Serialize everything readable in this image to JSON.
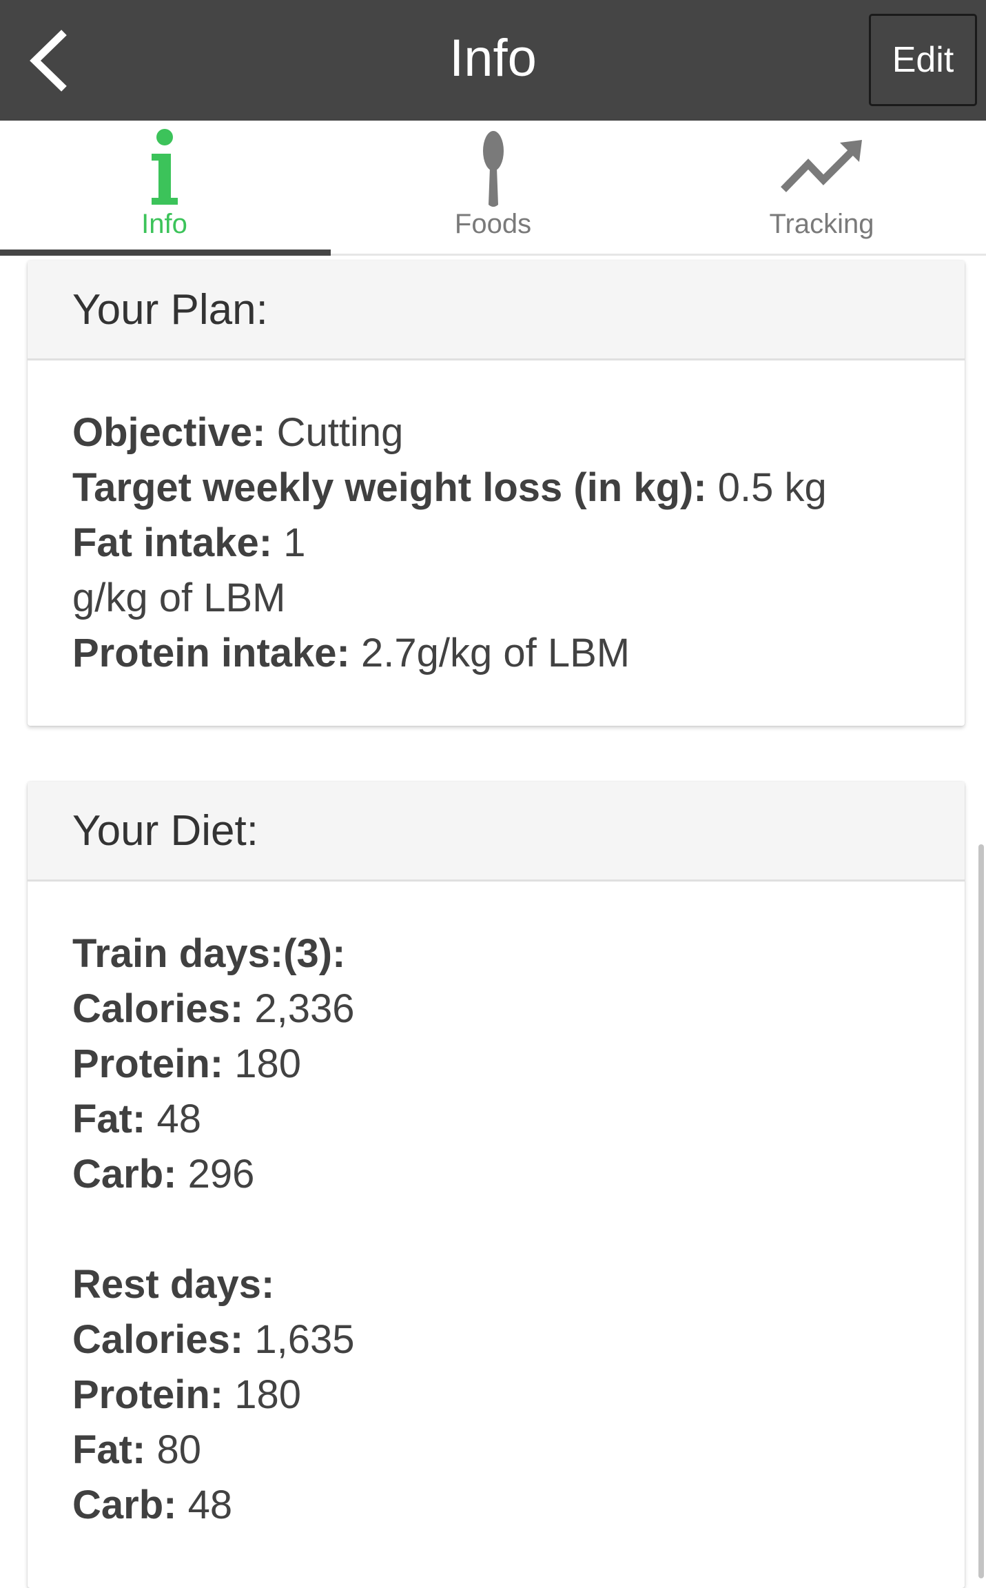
{
  "appbar": {
    "title": "Info",
    "edit_label": "Edit",
    "back_icon": "chevron-left-icon"
  },
  "tabs": [
    {
      "label": "Info",
      "icon": "info-icon",
      "active": true
    },
    {
      "label": "Foods",
      "icon": "spoon-icon",
      "active": false
    },
    {
      "label": "Tracking",
      "icon": "trend-up-icon",
      "active": false
    }
  ],
  "colors": {
    "appbar": "#454545",
    "active_tab": "#3cc35a",
    "inactive_tab": "#7a7a7a",
    "card_header_bg": "#f5f5f5"
  },
  "plan": {
    "header": "Your Plan:",
    "objective_label": "Objective:",
    "objective_value": "Cutting",
    "weekly_loss_label": "Target weekly weight loss (in kg):",
    "weekly_loss_value": "0.5 kg",
    "fat_label": "Fat intake:",
    "fat_value_1": "1",
    "fat_value_2": "g/kg of LBM",
    "protein_label": "Protein intake:",
    "protein_value": "2.7g/kg of LBM"
  },
  "diet": {
    "header": "Your Diet:",
    "train": {
      "title": "Train days:(3):",
      "calories_label": "Calories:",
      "calories": "2,336",
      "protein_label": "Protein:",
      "protein": "180",
      "fat_label": "Fat:",
      "fat": "48",
      "carb_label": "Carb:",
      "carb": "296"
    },
    "rest": {
      "title": "Rest days:",
      "calories_label": "Calories:",
      "calories": "1,635",
      "protein_label": "Protein:",
      "protein": "180",
      "fat_label": "Fat:",
      "fat": "80",
      "carb_label": "Carb:",
      "carb": "48"
    }
  }
}
